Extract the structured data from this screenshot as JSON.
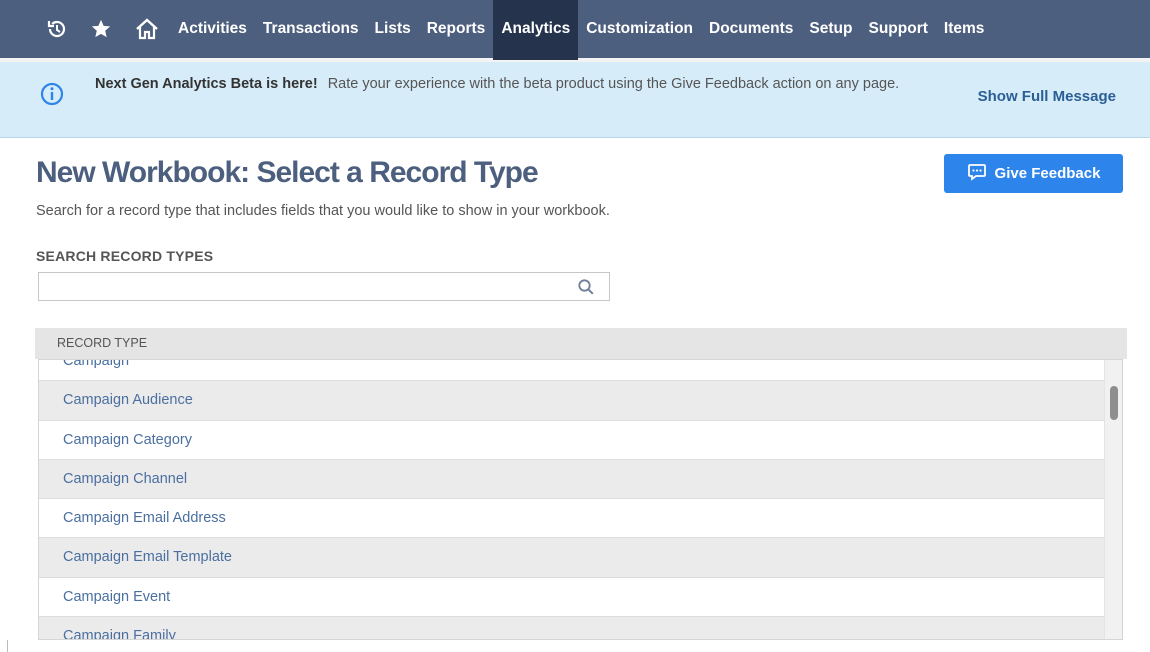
{
  "nav": {
    "icons": [
      "recent-icon",
      "star-icon",
      "home-icon"
    ],
    "items": [
      "Activities",
      "Transactions",
      "Lists",
      "Reports",
      "Analytics",
      "Customization",
      "Documents",
      "Setup",
      "Support",
      "Items"
    ],
    "active_item": "Analytics",
    "colors": {
      "bar": "#4d5f7e",
      "active": "#26334d"
    }
  },
  "banner": {
    "title": "Next Gen Analytics Beta is here!",
    "message": "Rate your experience with the beta product using the Give Feedback action on any page.",
    "show_full": "Show Full Message",
    "icon": "info-icon"
  },
  "page": {
    "title": "New Workbook: Select a Record Type",
    "description": "Search for a record type that includes fields that you would like to show in your workbook.",
    "feedback_button": "Give Feedback"
  },
  "search": {
    "label": "SEARCH RECORD TYPES",
    "value": "",
    "placeholder": ""
  },
  "table": {
    "column_header": "RECORD TYPE",
    "rows": [
      "Campaign",
      "Campaign Audience",
      "Campaign Category",
      "Campaign Channel",
      "Campaign Email Address",
      "Campaign Email Template",
      "Campaign Event",
      "Campaign Family"
    ]
  }
}
